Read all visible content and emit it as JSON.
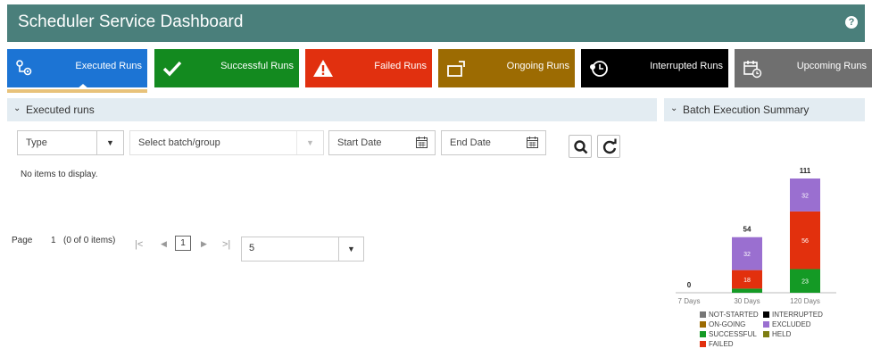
{
  "header": {
    "title": "Scheduler Service Dashboard",
    "help_icon": "?"
  },
  "tiles": [
    {
      "label": "Executed Runs",
      "color": "#1c74d4",
      "icon": "executed-runs-icon",
      "selected": true
    },
    {
      "label": "Successful Runs",
      "color": "#138a1f",
      "icon": "checkmark-icon"
    },
    {
      "label": "Failed Runs",
      "color": "#e1300f",
      "icon": "warning-icon"
    },
    {
      "label": "Ongoing Runs",
      "color": "#9c6b02",
      "icon": "ongoing-icon"
    },
    {
      "label": "Interrupted Runs",
      "color": "#000000",
      "icon": "interrupted-icon"
    },
    {
      "label": "Upcoming Runs",
      "color": "#6f6f6f",
      "icon": "calendar-clock-icon"
    }
  ],
  "executed_panel": {
    "title": "Executed runs",
    "filters": {
      "type_placeholder": "Type",
      "batch_placeholder": "Select batch/group",
      "start_date_placeholder": "Start Date",
      "end_date_placeholder": "End Date"
    },
    "empty_message": "No items to display.",
    "pagination": {
      "page_label": "Page",
      "current_page": "1",
      "summary": "(0 of 0 items)",
      "page_box": "1",
      "page_size": "5"
    }
  },
  "summary_panel": {
    "title": "Batch Execution Summary"
  },
  "chart_data": {
    "type": "bar",
    "stacked": true,
    "categories": [
      "7 Days",
      "30 Days",
      "120 Days"
    ],
    "totals": [
      0,
      54,
      111
    ],
    "series": [
      {
        "name": "NOT-STARTED",
        "color": "#777777",
        "values": [
          0,
          0,
          0
        ]
      },
      {
        "name": "INTERRUPTED",
        "color": "#000000",
        "values": [
          0,
          0,
          0
        ]
      },
      {
        "name": "ON-GOING",
        "color": "#9c6b02",
        "values": [
          0,
          0,
          0
        ]
      },
      {
        "name": "EXCLUDED",
        "color": "#9a6fd0",
        "values": [
          0,
          32,
          32
        ]
      },
      {
        "name": "SUCCESSFUL",
        "color": "#149a25",
        "values": [
          0,
          4,
          23
        ]
      },
      {
        "name": "HELD",
        "color": "#7d7d12",
        "values": [
          0,
          0,
          0
        ]
      },
      {
        "name": "FAILED",
        "color": "#e2300d",
        "values": [
          0,
          18,
          56
        ]
      }
    ],
    "data_labels": [
      {
        "category": "30 Days",
        "series": "EXCLUDED",
        "text": "32"
      },
      {
        "category": "30 Days",
        "series": "FAILED",
        "text": "18"
      },
      {
        "category": "120 Days",
        "series": "EXCLUDED",
        "text": "32"
      },
      {
        "category": "120 Days",
        "series": "FAILED",
        "text": "56"
      },
      {
        "category": "120 Days",
        "series": "SUCCESSFUL",
        "text": "23"
      }
    ],
    "legend_position": "bottom",
    "grid": false
  }
}
